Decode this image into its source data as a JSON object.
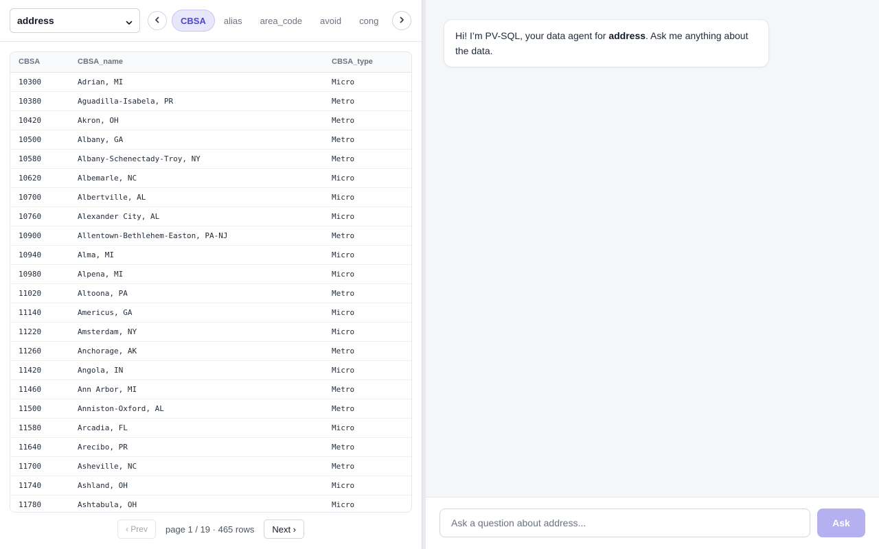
{
  "table_selector": {
    "value": "address",
    "icon": "chevron-down-icon"
  },
  "column_tabs": {
    "prev_icon": "chevron-left-icon",
    "next_icon": "chevron-right-icon",
    "items": [
      "CBSA",
      "alias",
      "area_code",
      "avoid",
      "cong"
    ],
    "active": "CBSA"
  },
  "table": {
    "headers": [
      "CBSA",
      "CBSA_name",
      "CBSA_type"
    ],
    "rows": [
      [
        "10300",
        "Adrian, MI",
        "Micro"
      ],
      [
        "10380",
        "Aguadilla-Isabela, PR",
        "Metro"
      ],
      [
        "10420",
        "Akron, OH",
        "Metro"
      ],
      [
        "10500",
        "Albany, GA",
        "Metro"
      ],
      [
        "10580",
        "Albany-Schenectady-Troy, NY",
        "Metro"
      ],
      [
        "10620",
        "Albemarle, NC",
        "Micro"
      ],
      [
        "10700",
        "Albertville, AL",
        "Micro"
      ],
      [
        "10760",
        "Alexander City, AL",
        "Micro"
      ],
      [
        "10900",
        "Allentown-Bethlehem-Easton, PA-NJ",
        "Metro"
      ],
      [
        "10940",
        "Alma, MI",
        "Micro"
      ],
      [
        "10980",
        "Alpena, MI",
        "Micro"
      ],
      [
        "11020",
        "Altoona, PA",
        "Metro"
      ],
      [
        "11140",
        "Americus, GA",
        "Micro"
      ],
      [
        "11220",
        "Amsterdam, NY",
        "Micro"
      ],
      [
        "11260",
        "Anchorage, AK",
        "Metro"
      ],
      [
        "11420",
        "Angola, IN",
        "Micro"
      ],
      [
        "11460",
        "Ann Arbor, MI",
        "Metro"
      ],
      [
        "11500",
        "Anniston-Oxford, AL",
        "Metro"
      ],
      [
        "11580",
        "Arcadia, FL",
        "Micro"
      ],
      [
        "11640",
        "Arecibo, PR",
        "Metro"
      ],
      [
        "11700",
        "Asheville, NC",
        "Metro"
      ],
      [
        "11740",
        "Ashland, OH",
        "Micro"
      ],
      [
        "11780",
        "Ashtabula, OH",
        "Micro"
      ]
    ]
  },
  "pagination": {
    "prev_label": "‹ Prev",
    "next_label": "Next ›",
    "info": "page 1 / 19 · 465 rows"
  },
  "chat": {
    "greeting_pre": "Hi! I’m PV-SQL, your data agent for ",
    "greeting_bold": "address",
    "greeting_post": ". Ask me anything about the data.",
    "input_placeholder": "Ask a question about address...",
    "ask_label": "Ask"
  },
  "colors": {
    "accent": "#4f46c8",
    "accent_soft": "#e8e6f9",
    "ask_button": "#b5b0ef"
  }
}
